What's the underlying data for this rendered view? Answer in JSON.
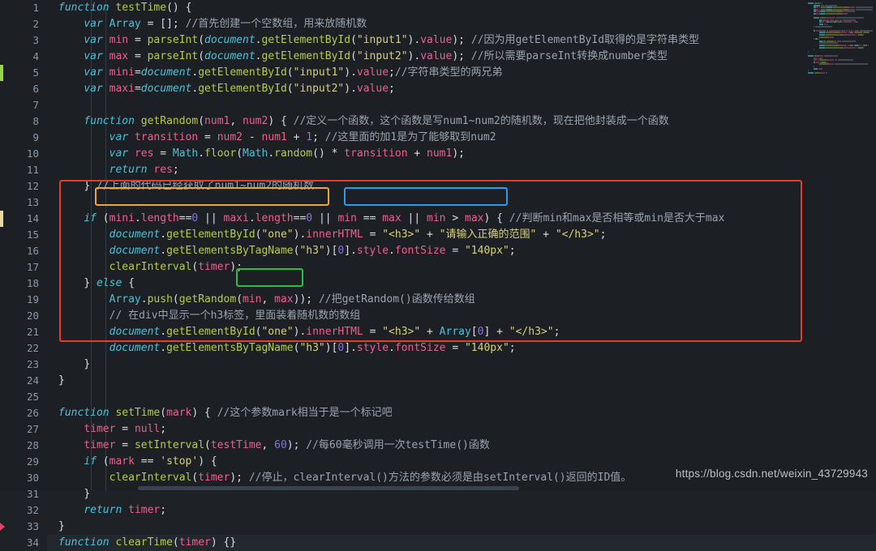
{
  "editor": {
    "theme_background": "#1c2025",
    "font_size_px": 13,
    "line_height_px": 20,
    "first_line": 1,
    "last_line": 34,
    "active_line": 34,
    "language": "javascript"
  },
  "gutter": {
    "line_numbers": [
      1,
      2,
      3,
      4,
      5,
      6,
      7,
      8,
      9,
      10,
      11,
      12,
      13,
      14,
      15,
      16,
      17,
      18,
      19,
      20,
      21,
      22,
      23,
      24,
      25,
      26,
      27,
      28,
      29,
      30,
      31,
      32,
      33,
      34
    ],
    "markers": [
      {
        "line": 5,
        "color": "#9bd44a",
        "kind": "added-change-marker"
      },
      {
        "line": 14,
        "color": "#e8d9a0",
        "kind": "modified-change-marker"
      },
      {
        "line": 33,
        "color": "#e0436a",
        "kind": "breakpoint-arrow"
      }
    ]
  },
  "code_lines": [
    {
      "n": 1,
      "text": "function testTime() {"
    },
    {
      "n": 2,
      "text": "    var Array = []; //首先创建一个空数组，用来放随机数"
    },
    {
      "n": 3,
      "text": "    var min = parseInt(document.getElementById(\"input1\").value); //因为用getElementById取得的是字符串类型"
    },
    {
      "n": 4,
      "text": "    var max = parseInt(document.getElementById(\"input2\").value); //所以需要parseInt转换成number类型"
    },
    {
      "n": 5,
      "text": "    var mini=document.getElementById(\"input1\").value;//字符串类型的两兄弟"
    },
    {
      "n": 6,
      "text": "    var maxi=document.getElementById(\"input2\").value;"
    },
    {
      "n": 7,
      "text": ""
    },
    {
      "n": 8,
      "text": "    function getRandom(num1, num2) { //定义一个函数，这个函数是写num1~num2的随机数，现在把他封装成一个函数"
    },
    {
      "n": 9,
      "text": "        var transition = num2 - num1 + 1; //这里面的加1是为了能够取到num2"
    },
    {
      "n": 10,
      "text": "        var res = Math.floor(Math.random() * transition + num1);"
    },
    {
      "n": 11,
      "text": "        return res;"
    },
    {
      "n": 12,
      "text": "    } //上面的代码已经获取了num1~num2的随机数"
    },
    {
      "n": 13,
      "text": ""
    },
    {
      "n": 14,
      "text": "    if (mini.length==0 || maxi.length==0 || min == max || min > max) { //判断min和max是否相等或min是否大于max"
    },
    {
      "n": 15,
      "text": "        document.getElementById(\"one\").innerHTML = \"<h3>\" + \"请输入正确的范围\" + \"</h3>\";"
    },
    {
      "n": 16,
      "text": "        document.getElementsByTagName(\"h3\")[0].style.fontSize = \"140px\";"
    },
    {
      "n": 17,
      "text": "        clearInterval(timer);"
    },
    {
      "n": 18,
      "text": "    } else {"
    },
    {
      "n": 19,
      "text": "        Array.push(getRandom(min, max)); //把getRandom()函数传给数组"
    },
    {
      "n": 20,
      "text": "        // 在div中显示一个h3标签，里面装着随机数的数组"
    },
    {
      "n": 21,
      "text": "        document.getElementById(\"one\").innerHTML = \"<h3>\" + Array[0] + \"</h3>\";"
    },
    {
      "n": 22,
      "text": "        document.getElementsByTagName(\"h3\")[0].style.fontSize = \"140px\";"
    },
    {
      "n": 23,
      "text": "    }"
    },
    {
      "n": 24,
      "text": "}"
    },
    {
      "n": 25,
      "text": ""
    },
    {
      "n": 26,
      "text": "function setTime(mark) { //这个参数mark相当于是一个标记吧"
    },
    {
      "n": 27,
      "text": "    timer = null;"
    },
    {
      "n": 28,
      "text": "    timer = setInterval(testTime, 60); //每60毫秒调用一次testTime()函数"
    },
    {
      "n": 29,
      "text": "    if (mark == 'stop') {"
    },
    {
      "n": 30,
      "text": "        clearInterval(timer); //停止，clearInterval()方法的参数必须是由setInterval()返回的ID值。"
    },
    {
      "n": 31,
      "text": "    }"
    },
    {
      "n": 32,
      "text": "    return timer;"
    },
    {
      "n": 33,
      "text": "}"
    },
    {
      "n": 34,
      "text": "function clearTime(timer) {}"
    }
  ],
  "annotations": [
    {
      "id": "outer-red-box",
      "color": "#e83b2c",
      "covers_lines": "14-24",
      "shape": "rectangle",
      "label": ""
    },
    {
      "id": "orange-box",
      "color": "#e8a83b",
      "covers": "mini.length==0 || maxi.length==0",
      "shape": "rectangle",
      "label": ""
    },
    {
      "id": "blue-box",
      "color": "#2d9bf0",
      "covers": "min == max || min > max",
      "shape": "rectangle",
      "label": ""
    },
    {
      "id": "green-box",
      "color": "#2fbe45",
      "covers": "min, max",
      "shape": "rectangle",
      "label": ""
    }
  ],
  "watermark": {
    "text": "https://blog.csdn.net/weixin_43729943"
  },
  "minimap": {
    "visible": true,
    "position": "right"
  }
}
